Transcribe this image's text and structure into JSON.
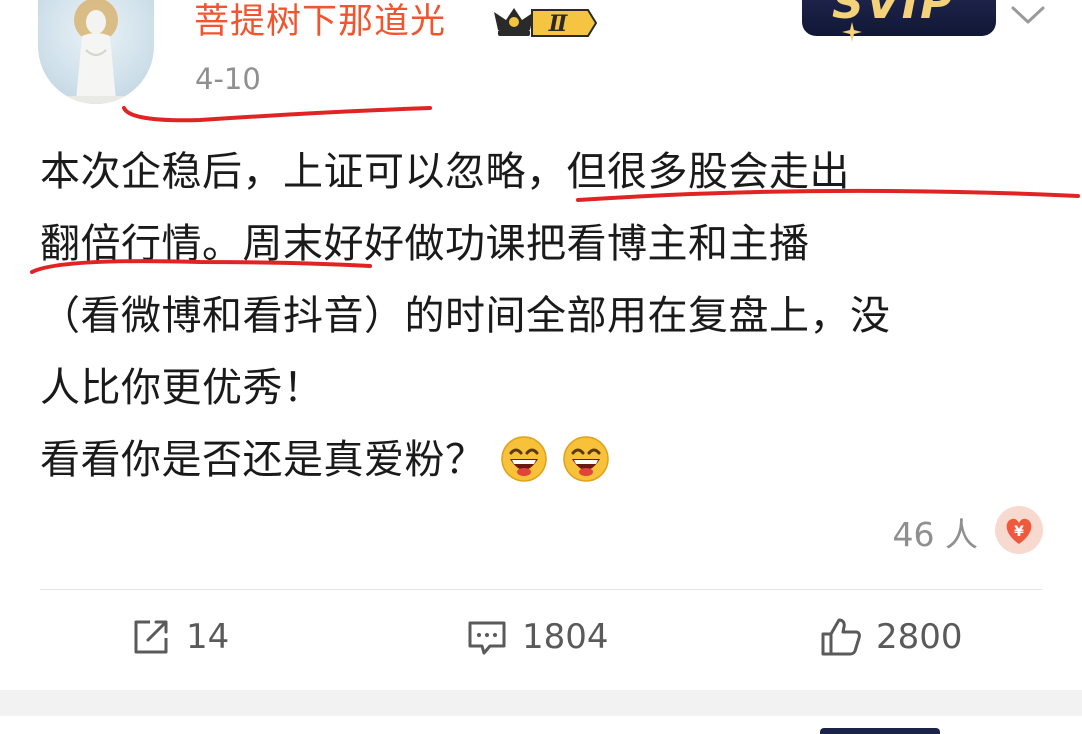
{
  "post": {
    "author": "菩提树下那道光",
    "vip_level": "Ⅱ",
    "date": "4-10",
    "text_lines": [
      "本次企稳后，上证可以忽略，但很多股会走出",
      "翻倍行情。周末好好做功课把看博主和主播",
      "（看微博和看抖音）的时间全部用在复盘上，没",
      "人比你更优秀！",
      "看看你是否还是真爱粉？"
    ],
    "emojis": [
      "laughing-face",
      "laughing-face"
    ],
    "reward_count": "46 人"
  },
  "actions": {
    "repost_count": "14",
    "comment_count": "1804",
    "like_count": "2800"
  },
  "colors": {
    "author": "#f2542d",
    "annotation": "#e02424",
    "meta_text": "#8f8f8f"
  },
  "icons": [
    "more-chevron-icon",
    "vip-crown-icon",
    "reward-yen-icon",
    "repost-icon",
    "comment-icon",
    "like-icon"
  ]
}
